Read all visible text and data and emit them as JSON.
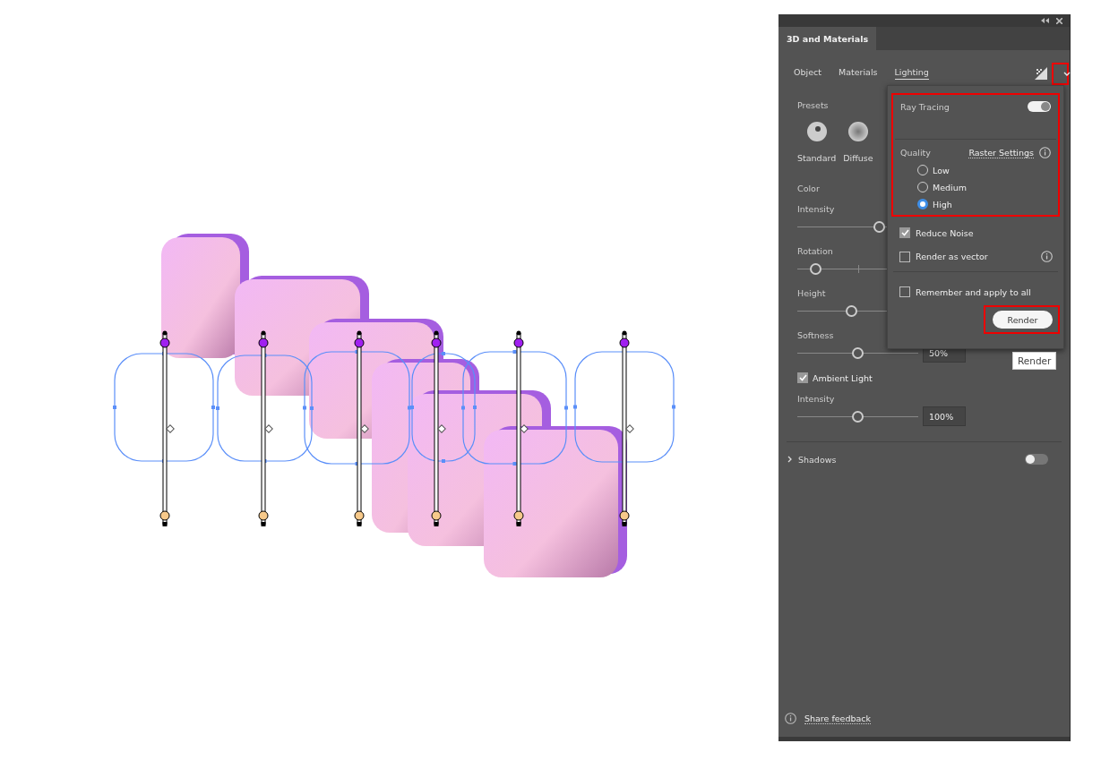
{
  "panel_tab": {
    "label": "3D and Materials",
    "selected": true
  },
  "tabs": [
    {
      "label": "Object",
      "selected": false
    },
    {
      "label": "Materials",
      "selected": false
    },
    {
      "label": "Lighting",
      "selected": true
    }
  ],
  "menu_button": {
    "highlighted": true
  },
  "presets": {
    "label": "Presets",
    "items": [
      {
        "label": "Standard",
        "kind": "standard"
      },
      {
        "label": "Diffuse",
        "kind": "diffuse"
      }
    ]
  },
  "color": {
    "label": "Color"
  },
  "sliders": [
    {
      "label": "Intensity",
      "level": 0.68
    },
    {
      "label": "Rotation",
      "level": 0.15,
      "kind": "centered"
    },
    {
      "label": "Height",
      "level": 0.45
    },
    {
      "label": "Softness",
      "level": 0.5,
      "value": "50%"
    }
  ],
  "ambient_light": {
    "label": "Ambient Light",
    "checked": true,
    "slider": {
      "label": "Intensity",
      "level": 0.5,
      "value": "100%"
    }
  },
  "shadows": {
    "label": "Shadows",
    "expanded": false,
    "on": false
  },
  "footer": {
    "label": "Share feedback"
  },
  "render_popover": {
    "ray_tracing": {
      "label": "Ray Tracing",
      "on": true,
      "highlighted": true,
      "quality_label": "Quality",
      "raster_settings": "Raster Settings",
      "options": [
        {
          "label": "Low",
          "selected": false
        },
        {
          "label": "Medium",
          "selected": false
        },
        {
          "label": "High",
          "selected": true
        }
      ]
    },
    "checkboxes": [
      {
        "label": "Reduce Noise",
        "checked": true,
        "info": false
      },
      {
        "label": "Render as vector",
        "checked": false,
        "info": true
      }
    ],
    "remember": {
      "label": "Remember and apply to all",
      "checked": false
    },
    "render_button": {
      "label": "Render",
      "highlighted": true
    }
  },
  "tooltip": {
    "text": "Render"
  }
}
